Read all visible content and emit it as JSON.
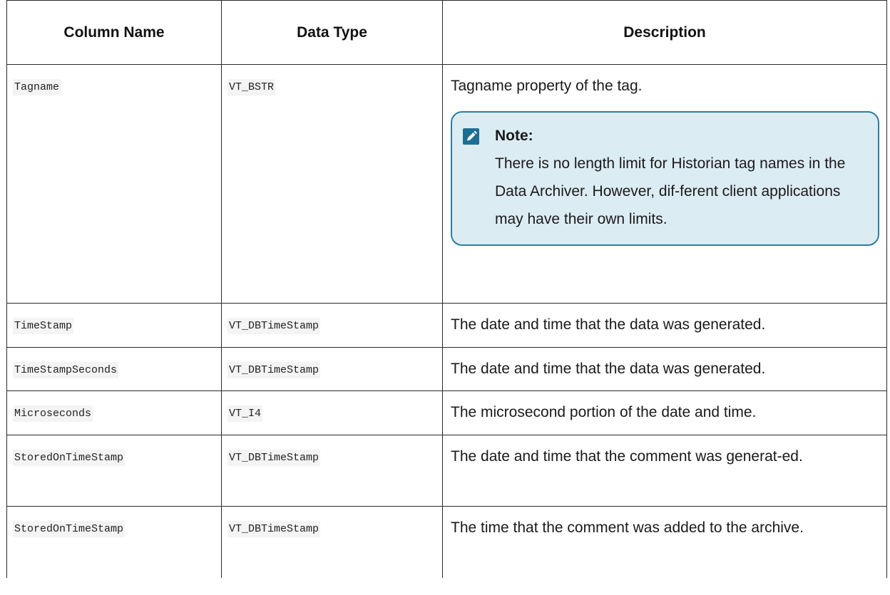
{
  "table": {
    "headers": [
      "Column Name",
      "Data Type",
      "Description"
    ],
    "rows": [
      {
        "name": "Tagname",
        "type": "VT_BSTR",
        "desc": "Tagname property of the tag."
      },
      {
        "name": "TimeStamp",
        "type": "VT_DBTimeStamp",
        "desc": "The date and time that the data was generated."
      },
      {
        "name": "TimeStampSeconds",
        "type": "VT_DBTimeStamp",
        "desc": "The date and time that the data was generated."
      },
      {
        "name": "Microseconds",
        "type": "VT_I4",
        "desc": "The microsecond portion of the date and time."
      },
      {
        "name": "StoredOnTimeStamp",
        "type": "VT_DBTimeStamp",
        "desc": "The date and time that the comment was generat-ed."
      },
      {
        "name": "StoredOnTimeStamp",
        "type": "VT_DBTimeStamp",
        "desc": "The time that the comment was added to the archive."
      }
    ]
  },
  "note": {
    "icon": "pencil-note-icon",
    "label": "Note:",
    "text": "There is no length limit for Historian tag names in the Data Archiver. However, dif-ferent client applications may have their own limits.",
    "border_color": "#2b7ea1",
    "background_color": "#dcecf3"
  }
}
